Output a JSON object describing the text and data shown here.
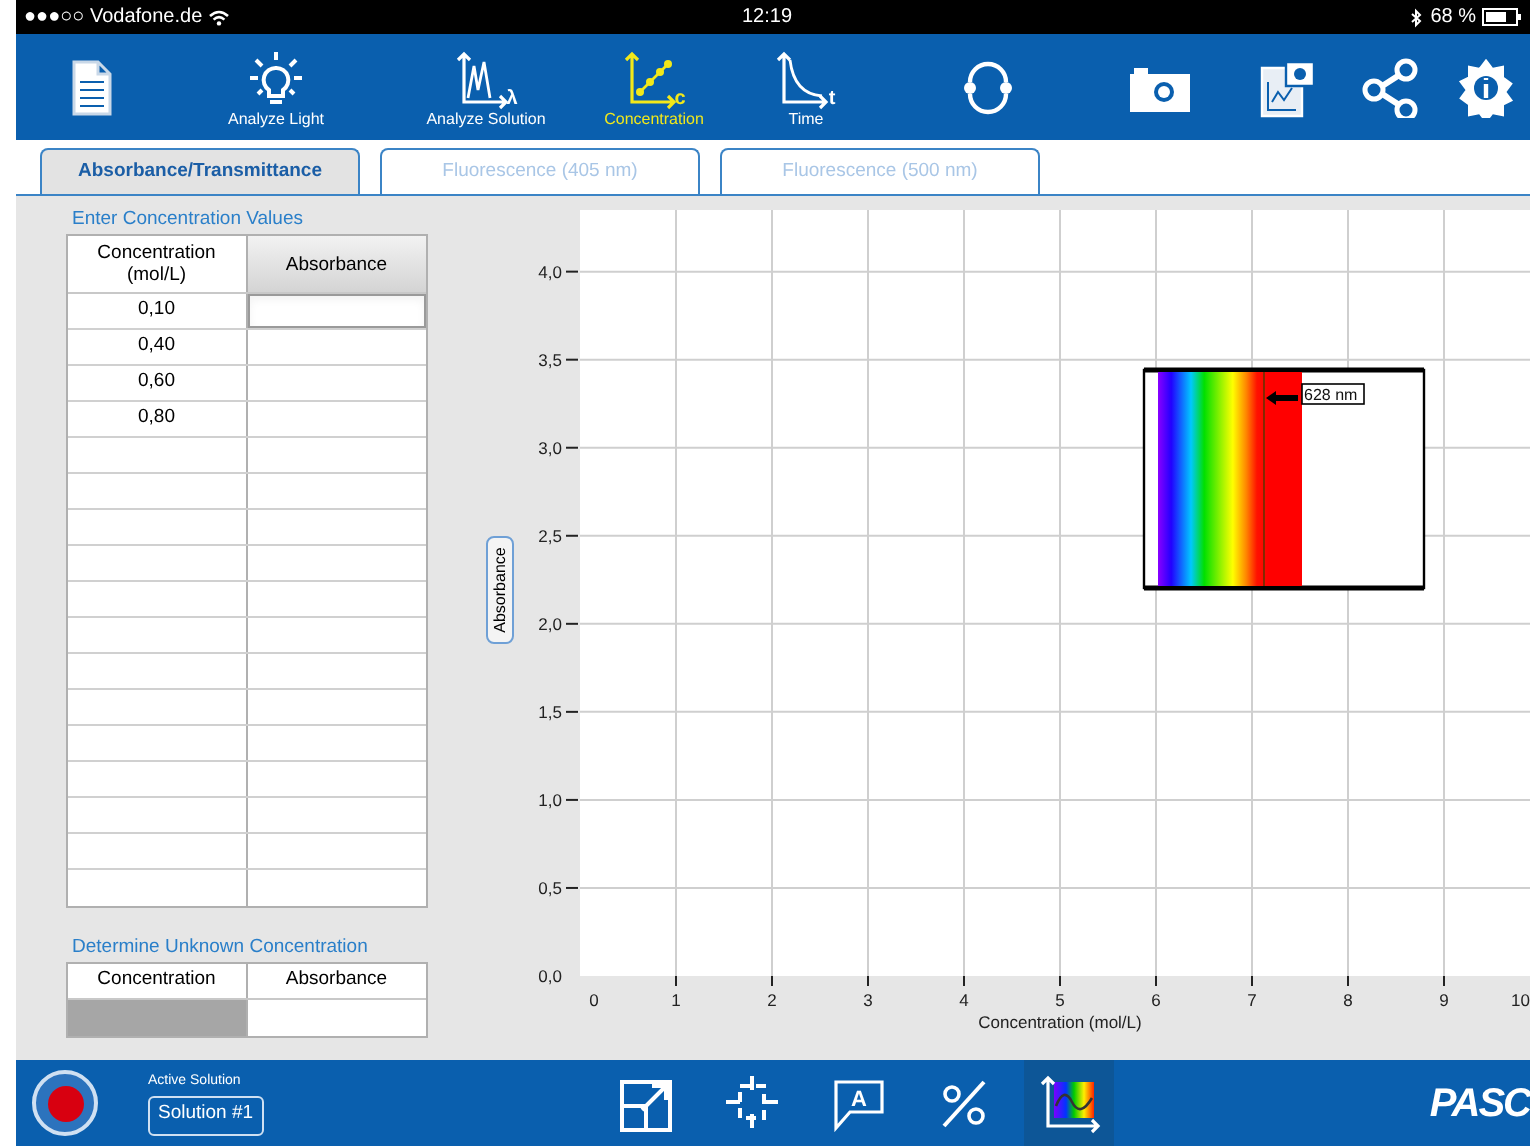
{
  "status_bar": {
    "carrier": "●●●○○ Vodafone.de",
    "time": "12:19",
    "battery": "68 %"
  },
  "toolbar": [
    {
      "kind": "document"
    },
    {
      "kind": "bulb",
      "label": "Analyze Light",
      "selected": false
    },
    {
      "kind": "spectrum",
      "label": "Analyze Solution",
      "glyph": "λ",
      "selected": false
    },
    {
      "kind": "concentration",
      "label": "Concentration",
      "glyph": "c",
      "selected": true
    },
    {
      "kind": "time",
      "label": "Time",
      "glyph": "t",
      "selected": false
    },
    {
      "kind": "sync"
    },
    {
      "kind": "camera"
    },
    {
      "kind": "snapshot"
    },
    {
      "kind": "share"
    },
    {
      "kind": "settings"
    }
  ],
  "tabs": [
    {
      "label": "Absorbance/Transmittance",
      "selected": true
    },
    {
      "label": "Fluorescence (405 nm)",
      "selected": false
    },
    {
      "label": "Fluorescence (500 nm)",
      "selected": false
    }
  ],
  "concentration_table": {
    "title": "Enter Concentration Values",
    "columns": [
      {
        "label": "Concentration\n(mol/L)",
        "selected": false
      },
      {
        "label": "Absorbance",
        "selected": true
      }
    ],
    "rows": [
      {
        "concentration": "0,10",
        "focused": true
      },
      {
        "concentration": "0,40",
        "focused": false
      },
      {
        "concentration": "0,60",
        "focused": false
      },
      {
        "concentration": "0,80",
        "focused": false
      }
    ]
  },
  "unknown_table": {
    "title": "Determine Unknown Concentration",
    "columns": [
      "Concentration",
      "Absorbance"
    ],
    "concentration_disabled": true
  },
  "chart": {
    "chart_data": {
      "type": "scatter",
      "xlabel": "Concentration (mol/L)",
      "ylabel": "Absorbance",
      "grid": true,
      "xlim": [
        0,
        10
      ],
      "ylim": [
        0,
        4.35
      ],
      "xticks": [
        0,
        1,
        2,
        3,
        4,
        5,
        6,
        7,
        8,
        9,
        10
      ],
      "yticks": [
        {
          "value": 0,
          "label": "0,0"
        },
        {
          "value": 0.5,
          "label": "0,5"
        },
        {
          "value": 1,
          "label": "1,0"
        },
        {
          "value": 1.5,
          "label": "1,5"
        },
        {
          "value": 2,
          "label": "2,0"
        },
        {
          "value": 2.5,
          "label": "2,5"
        },
        {
          "value": 3,
          "label": "3,0"
        },
        {
          "value": 3.5,
          "label": "3,5"
        },
        {
          "value": 4,
          "label": "4,0"
        }
      ]
    },
    "spectrum_inset": {
      "wavelength_label": "628 nm"
    }
  },
  "bottom_bar": {
    "active_solution_label": "Active Solution",
    "solution_button": "Solution #1",
    "tools": [
      {
        "kind": "scale",
        "selected": false
      },
      {
        "kind": "crosshair",
        "selected": false
      },
      {
        "kind": "annotation",
        "glyph": "A",
        "selected": false
      },
      {
        "kind": "percent",
        "selected": false
      },
      {
        "kind": "spectrum-graph",
        "selected": true
      }
    ],
    "logo": "PASC"
  }
}
